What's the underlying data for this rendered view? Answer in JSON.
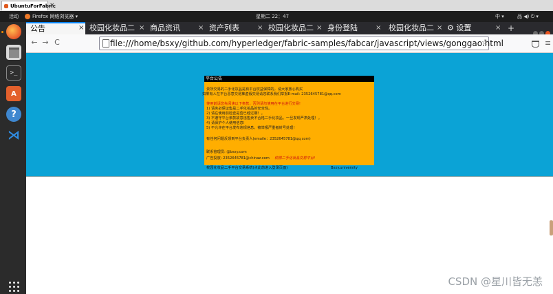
{
  "vm": {
    "tab_title": "UbuntuForFabric",
    "close_glyph": "×"
  },
  "gnome_bar": {
    "activities": "活动",
    "app_menu": "Firefox 网络浏览器 ▾",
    "clock": "星期二 22：47",
    "input_method": "中 ▾",
    "status_icons": "品 ◀) ⏻ ▾"
  },
  "dock": {
    "items": [
      {
        "name": "firefox",
        "icon": "firefox-icon",
        "glyph": ""
      },
      {
        "name": "files",
        "icon": "files-icon",
        "glyph": ""
      },
      {
        "name": "terminal",
        "icon": "terminal-icon",
        "glyph": ">_"
      },
      {
        "name": "software",
        "icon": "software-icon",
        "glyph": "A"
      },
      {
        "name": "help",
        "icon": "help-icon",
        "glyph": "?"
      },
      {
        "name": "vscode",
        "icon": "vscode-icon",
        "glyph": "⋊"
      }
    ]
  },
  "browser": {
    "tabs": [
      {
        "label": "公告",
        "active": true
      },
      {
        "label": "校园化妆品二",
        "active": false
      },
      {
        "label": "商品资讯",
        "active": false
      },
      {
        "label": "资产列表",
        "active": false
      },
      {
        "label": "校园化妆品二",
        "active": false
      },
      {
        "label": "身份登陆",
        "active": false
      },
      {
        "label": "校园化妆品二",
        "active": false
      },
      {
        "label": "⚙ 设置",
        "active": false
      }
    ],
    "tab_close_glyph": "×",
    "new_tab_glyph": "+",
    "tab_list_glyph": "⌄",
    "back_glyph": "←",
    "forward_glyph": "→",
    "reload_glyph": "C",
    "star_glyph": "☆",
    "menu_glyph": "≡",
    "url": "file:///home/bsxy/github.com/hyperledger/fabric-samples/fabcar/javascript/views/gonggao.html"
  },
  "colors": {
    "page_bg": "#0ba3d6",
    "notice_bg": "#ffae00",
    "tab_accent": "#0a84ff"
  },
  "notice": {
    "title": "平台公告",
    "lines": [
      {
        "text": "",
        "red": false
      },
      {
        "text": "贵所交易的二手化妆品是有平台权益保障的，请大家放心购买",
        "red": false
      },
      {
        "text": "如果有人在平台恶意交易推虚假交易请您联系我们举报E-mail: 2352645781@qq.com",
        "red": false
      },
      {
        "text": "",
        "red": false
      },
      {
        "text": "使用前请您先阅读以下条款，否则请勿使用在平台进行交易!",
        "red": true
      },
      {
        "text": "1) 请务必保证售是二手化妆品的安全性。",
        "red": false
      },
      {
        "text": "2) 请在使用前检查是否已经过期！。",
        "red": false
      },
      {
        "text": "3) 不遵守平台条款故意违售卖不合格二手化妆品。一旦发现严肃处理！。",
        "red": false
      },
      {
        "text": "4) 请保护个人使用信息!",
        "red": false
      },
      {
        "text": "5) 不允许在平台发布违规信息，被举报严重者封号处理!",
        "red": false
      },
      {
        "text": "",
        "red": false
      },
      {
        "text": "有任何问题反馈到平台负责人(emaile：2352645781@qq.com)",
        "red": false
      },
      {
        "text": "",
        "red": false
      },
      {
        "text": "联系管理员: @bsxy.com",
        "red": false
      }
    ],
    "ad_label": "广告投放: 2352645781@chinaz.com",
    "slogan": "校园二手化妆品交易平台!",
    "footer_left": "校园化妆品二手平台交易系统(点此前进入登录页面)",
    "footer_right": "Bsxy.university"
  },
  "watermark": "CSDN @星川皆无恙"
}
